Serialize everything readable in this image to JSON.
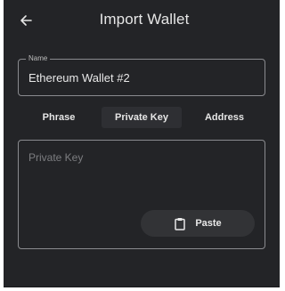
{
  "header": {
    "title": "Import Wallet",
    "back_icon": "arrow-left-icon"
  },
  "name_field": {
    "label": "Name",
    "value": "Ethereum Wallet #2"
  },
  "tabs": [
    {
      "label": "Phrase",
      "selected": false
    },
    {
      "label": "Private Key",
      "selected": true
    },
    {
      "label": "Address",
      "selected": false
    }
  ],
  "key_field": {
    "placeholder": "Private Key",
    "value": ""
  },
  "paste_button": {
    "label": "Paste",
    "icon": "clipboard-icon"
  },
  "colors": {
    "background": "#232427",
    "text": "#e6e6e6",
    "border": "#8a8b8f",
    "selected_tab": "#2e2f33",
    "button": "#323336"
  }
}
